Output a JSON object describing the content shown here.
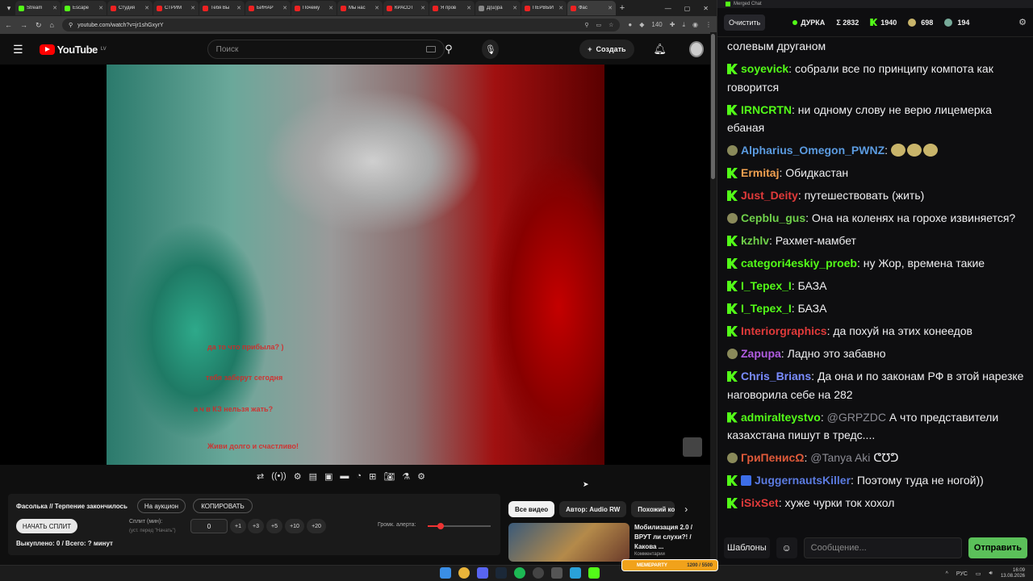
{
  "browser": {
    "tabs": [
      {
        "title": "Stream",
        "color": "#53fc18"
      },
      {
        "title": "Escape",
        "color": "#53fc18"
      },
      {
        "title": "Студия",
        "color": "#e22"
      },
      {
        "title": "СТРИМ",
        "color": "#e22"
      },
      {
        "title": "Тебя Вы",
        "color": "#e22"
      },
      {
        "title": "БИНАР",
        "color": "#e22"
      },
      {
        "title": "Почему",
        "color": "#e22"
      },
      {
        "title": "Мы нас",
        "color": "#e22"
      },
      {
        "title": "КРАСОТ",
        "color": "#e22"
      },
      {
        "title": "Я пров",
        "color": "#e22"
      },
      {
        "title": "Д(ш)ра",
        "color": "#888"
      },
      {
        "title": "ПЕРВЫЙ",
        "color": "#e22"
      },
      {
        "title": "Фас",
        "color": "#e22"
      }
    ],
    "url": "youtube.com/watch?v=jr1shGxyrY",
    "ext_badge": "140"
  },
  "youtube": {
    "logo": "YouTube",
    "region": "LV",
    "search_placeholder": "Поиск",
    "create_label": "Создать"
  },
  "video": {
    "overlay_lines": [
      "да то что прибыла? )",
      "тебя заберут сегодня",
      "а ч в КЗ нельзя жать?",
      "Живи долго и счастливо!"
    ]
  },
  "auction": {
    "title": "Фасолька // Терпение закончилось",
    "on_auction": "На аукцион",
    "copy": "КОПИРОВАТЬ",
    "start_split": "НАЧАТЬ СПЛИТ",
    "split_label": "Сплит (мин):",
    "split_hint": "(уст. перед \"Начать\")",
    "split_value": "0",
    "increments": [
      "+1",
      "+3",
      "+5",
      "+10",
      "+20"
    ],
    "alert_volume_label": "Громк. алерта:",
    "alert_volume": 0.2,
    "bought": "Выкуплено: 0 / Всего: ? минут"
  },
  "related": {
    "chips": [
      "Все видео",
      "Автор: Audio RW",
      "Похожий ко"
    ],
    "video_title": "Мобилизация 2.0 / ВРУТ ли слухи?! / Какова ...",
    "video_meta": "Комментарии"
  },
  "chat": {
    "window_title": "Merged Chat",
    "clear": "Очистить",
    "channel": "ДУРКА",
    "total": "Σ 2832",
    "kick_count": "1940",
    "other_count": "698",
    "third_count": "194",
    "messages": [
      {
        "user": "",
        "color": "#efeff1",
        "badge": "",
        "text": "солевым друганом"
      },
      {
        "user": "soyevick",
        "color": "#53fc18",
        "badge": "k",
        "text": "собрали все по принципу компота как говорится"
      },
      {
        "user": "IRNCRTN",
        "color": "#53fc18",
        "badge": "k",
        "text": "ни одному слову не верю лицемерка ебаная"
      },
      {
        "user": "Alpharius_Omegon_PWNZ",
        "color": "#5b9be0",
        "badge": "f",
        "text": "",
        "emotes": 3
      },
      {
        "user": "Ermitaj",
        "color": "#f0a050",
        "badge": "k",
        "text": "Обидкастан"
      },
      {
        "user": "Just_Deity",
        "color": "#e03a3a",
        "badge": "k",
        "text": "путешествовать (жить)"
      },
      {
        "user": "Cepblu_gus",
        "color": "#6fcf4a",
        "badge": "f",
        "text": "Она на коленях на горохе извиняется?"
      },
      {
        "user": "kzhlv",
        "color": "#6fcf4a",
        "badge": "k",
        "text": "Рахмет-мамбет"
      },
      {
        "user": "categori4eskiy_proeb",
        "color": "#53fc18",
        "badge": "k",
        "text": "ну Жор, времена такие"
      },
      {
        "user": "I_Tepex_I",
        "color": "#53fc18",
        "badge": "k",
        "text": "БАЗА"
      },
      {
        "user": "I_Tepex_I",
        "color": "#53fc18",
        "badge": "k",
        "text": "БАЗА"
      },
      {
        "user": "Interiorgraphics",
        "color": "#e03a3a",
        "badge": "k",
        "text": "да похуй на этих конеедов"
      },
      {
        "user": "Zapupa",
        "color": "#b05ce0",
        "badge": "f",
        "text": "Ладно это забавно"
      },
      {
        "user": "Chris_Brians",
        "color": "#7a8cff",
        "badge": "k",
        "text": "Да она и по законам РФ в этой нарезке наговорила себе на 282"
      },
      {
        "user": "admiralteystvo",
        "color": "#53fc18",
        "badge": "k",
        "mention": "@GRPZDC",
        "text": "А что представители казахстана пишут в тредс...."
      },
      {
        "user": "ГриПенисΩ",
        "color": "#e05a3a",
        "badge": "f",
        "mention": "@Tanya Aki",
        "text": "ᕦ℧ᕤ"
      },
      {
        "user": "JuggernautsKiller",
        "color": "#5b7be0",
        "badge": "kb",
        "text": "Поэтому туда не ногой))"
      },
      {
        "user": "iSixSet",
        "color": "#e03a3a",
        "badge": "k",
        "text": "хуже чурки ток хохол"
      }
    ],
    "templates": "Шаблоны",
    "input_placeholder": "Сообщение...",
    "send": "Отправить"
  },
  "taskbar": {
    "overlay": "MEMEPARTY",
    "overlay_progress": "1200 / 5500",
    "lang": "РУС",
    "time": "16:09",
    "date": "13.08.2026"
  }
}
